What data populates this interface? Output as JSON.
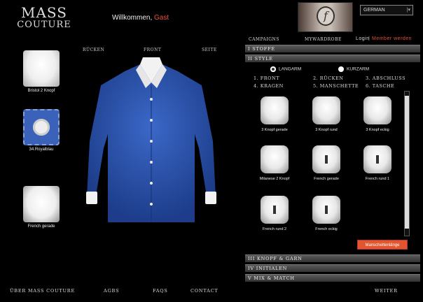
{
  "header": {
    "logo_line1": "MASS",
    "logo_line2": "COUTURE",
    "welcome": "Willkommen,",
    "guest": "Gast",
    "language": "GERMAN"
  },
  "top_nav": {
    "campaigns": "CAMPAIGNS",
    "mywardrobe": "MYWARDROBE",
    "login": "Login",
    "separator": "|",
    "member": "Member werden"
  },
  "view_tabs": [
    "RÜCKEN",
    "FRONT",
    "SEITE"
  ],
  "sidebar": [
    {
      "label": "Bristol 2 Knopf",
      "icon": "collar-icon"
    },
    {
      "label": "34.Royalblau",
      "icon": "button-fabric-icon"
    },
    {
      "label": "French gerade",
      "icon": "cuff-icon"
    }
  ],
  "accordion": {
    "s1": "I  STOFFE",
    "s2": "II  STYLE",
    "s3": "III  KNOPF  &  GARN",
    "s4": "IV  INITIALEN",
    "s5": "V  MIX  &  MATCH"
  },
  "sleeve": {
    "long": "LANGARM",
    "short": "KURZARM"
  },
  "style_subtabs": [
    "1. FRONT",
    "2. RÜCKEN",
    "3. ABSCHLUSS",
    "4. KRAGEN",
    "5. MANSCHETTE",
    "6. TASCHE"
  ],
  "cuffs": [
    "3 Knopf gerade",
    "3 Knopf rund",
    "3 Knopf eckig",
    "Milanese 2 Knopf",
    "French gerade",
    "French rund 1",
    "French rund 2",
    "French eckig"
  ],
  "manschette_button": "Manschettenlänge",
  "footer": {
    "about": "ÜBER  MASS  COUTURE",
    "agbs": "AGBS",
    "faqs": "FAQS",
    "contact": "CONTACT",
    "next": "WEITER"
  },
  "colors": {
    "accent": "#e8503a",
    "shirt": "#2d56b5"
  }
}
